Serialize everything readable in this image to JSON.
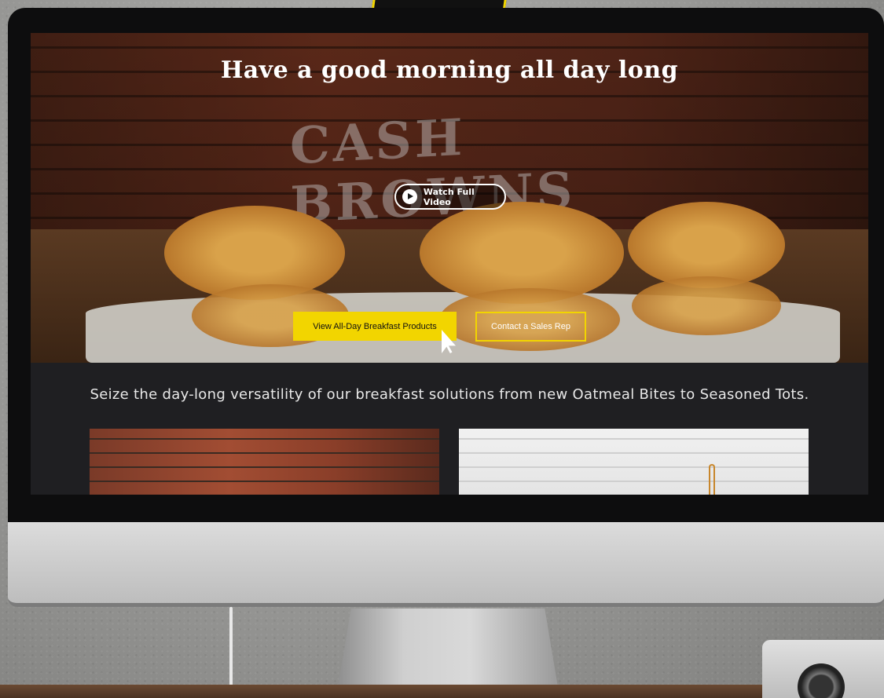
{
  "hero": {
    "title": "Have a good morning all day long",
    "background_text": "CASH BROWNS",
    "watch_video_label": "Watch Full Video"
  },
  "buttons": {
    "primary_label": "View All-Day Breakfast Products",
    "secondary_label": "Contact a Sales Rep"
  },
  "tagline": "Seize the day-long versatility of our breakfast solutions from new Oatmeal Bites to Seasoned Tots.",
  "colors": {
    "accent": "#f2d500",
    "screen_background": "#1f1f22"
  },
  "icons": {
    "play": "play-icon",
    "cursor": "cursor-icon"
  }
}
